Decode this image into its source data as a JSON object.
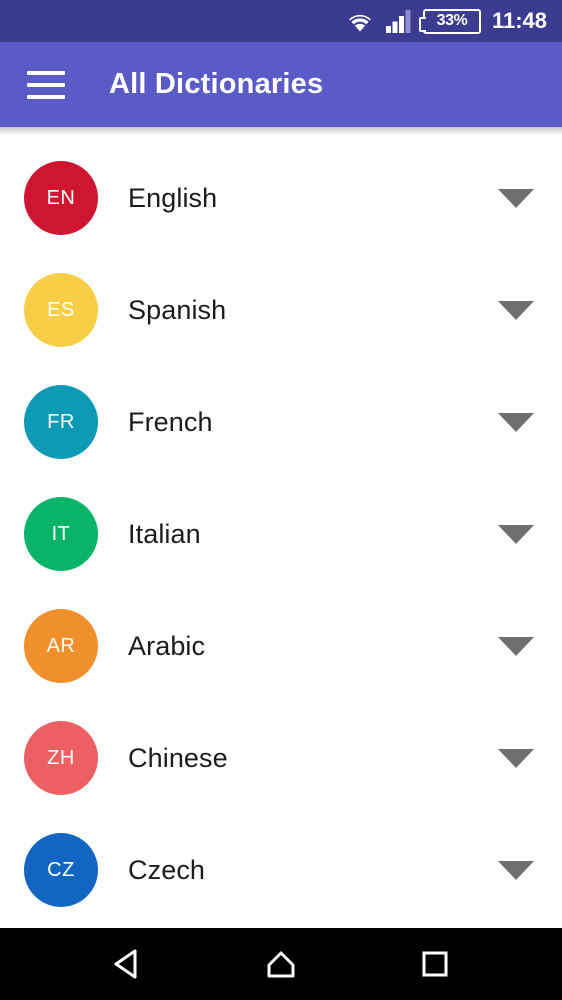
{
  "status_bar": {
    "background": "#3b3b8f",
    "wifi_icon": "wifi-icon",
    "signal_icon": "signal-bars-icon",
    "battery_icon": "battery-icon",
    "battery_level": "33%",
    "time": "11:48"
  },
  "app_bar": {
    "background": "#5b5bc7",
    "menu_icon": "hamburger-menu-icon",
    "title": "All Dictionaries"
  },
  "list": {
    "items": [
      {
        "code": "EN",
        "label": "English",
        "color": "#cf1631",
        "caret_icon": "chevron-down-icon"
      },
      {
        "code": "ES",
        "label": "Spanish",
        "color": "#f7cf46",
        "caret_icon": "chevron-down-icon"
      },
      {
        "code": "FR",
        "label": "French",
        "color": "#0d9ab5",
        "caret_icon": "chevron-down-icon"
      },
      {
        "code": "IT",
        "label": "Italian",
        "color": "#09b469",
        "caret_icon": "chevron-down-icon"
      },
      {
        "code": "AR",
        "label": "Arabic",
        "color": "#f0902c",
        "caret_icon": "chevron-down-icon"
      },
      {
        "code": "ZH",
        "label": "Chinese",
        "color": "#ec6063",
        "caret_icon": "chevron-down-icon"
      },
      {
        "code": "CZ",
        "label": "Czech",
        "color": "#1266c2",
        "caret_icon": "chevron-down-icon"
      }
    ]
  },
  "nav_bar": {
    "background": "#000000",
    "back_icon": "back-triangle-icon",
    "home_icon": "home-icon",
    "recents_icon": "recents-square-icon"
  }
}
